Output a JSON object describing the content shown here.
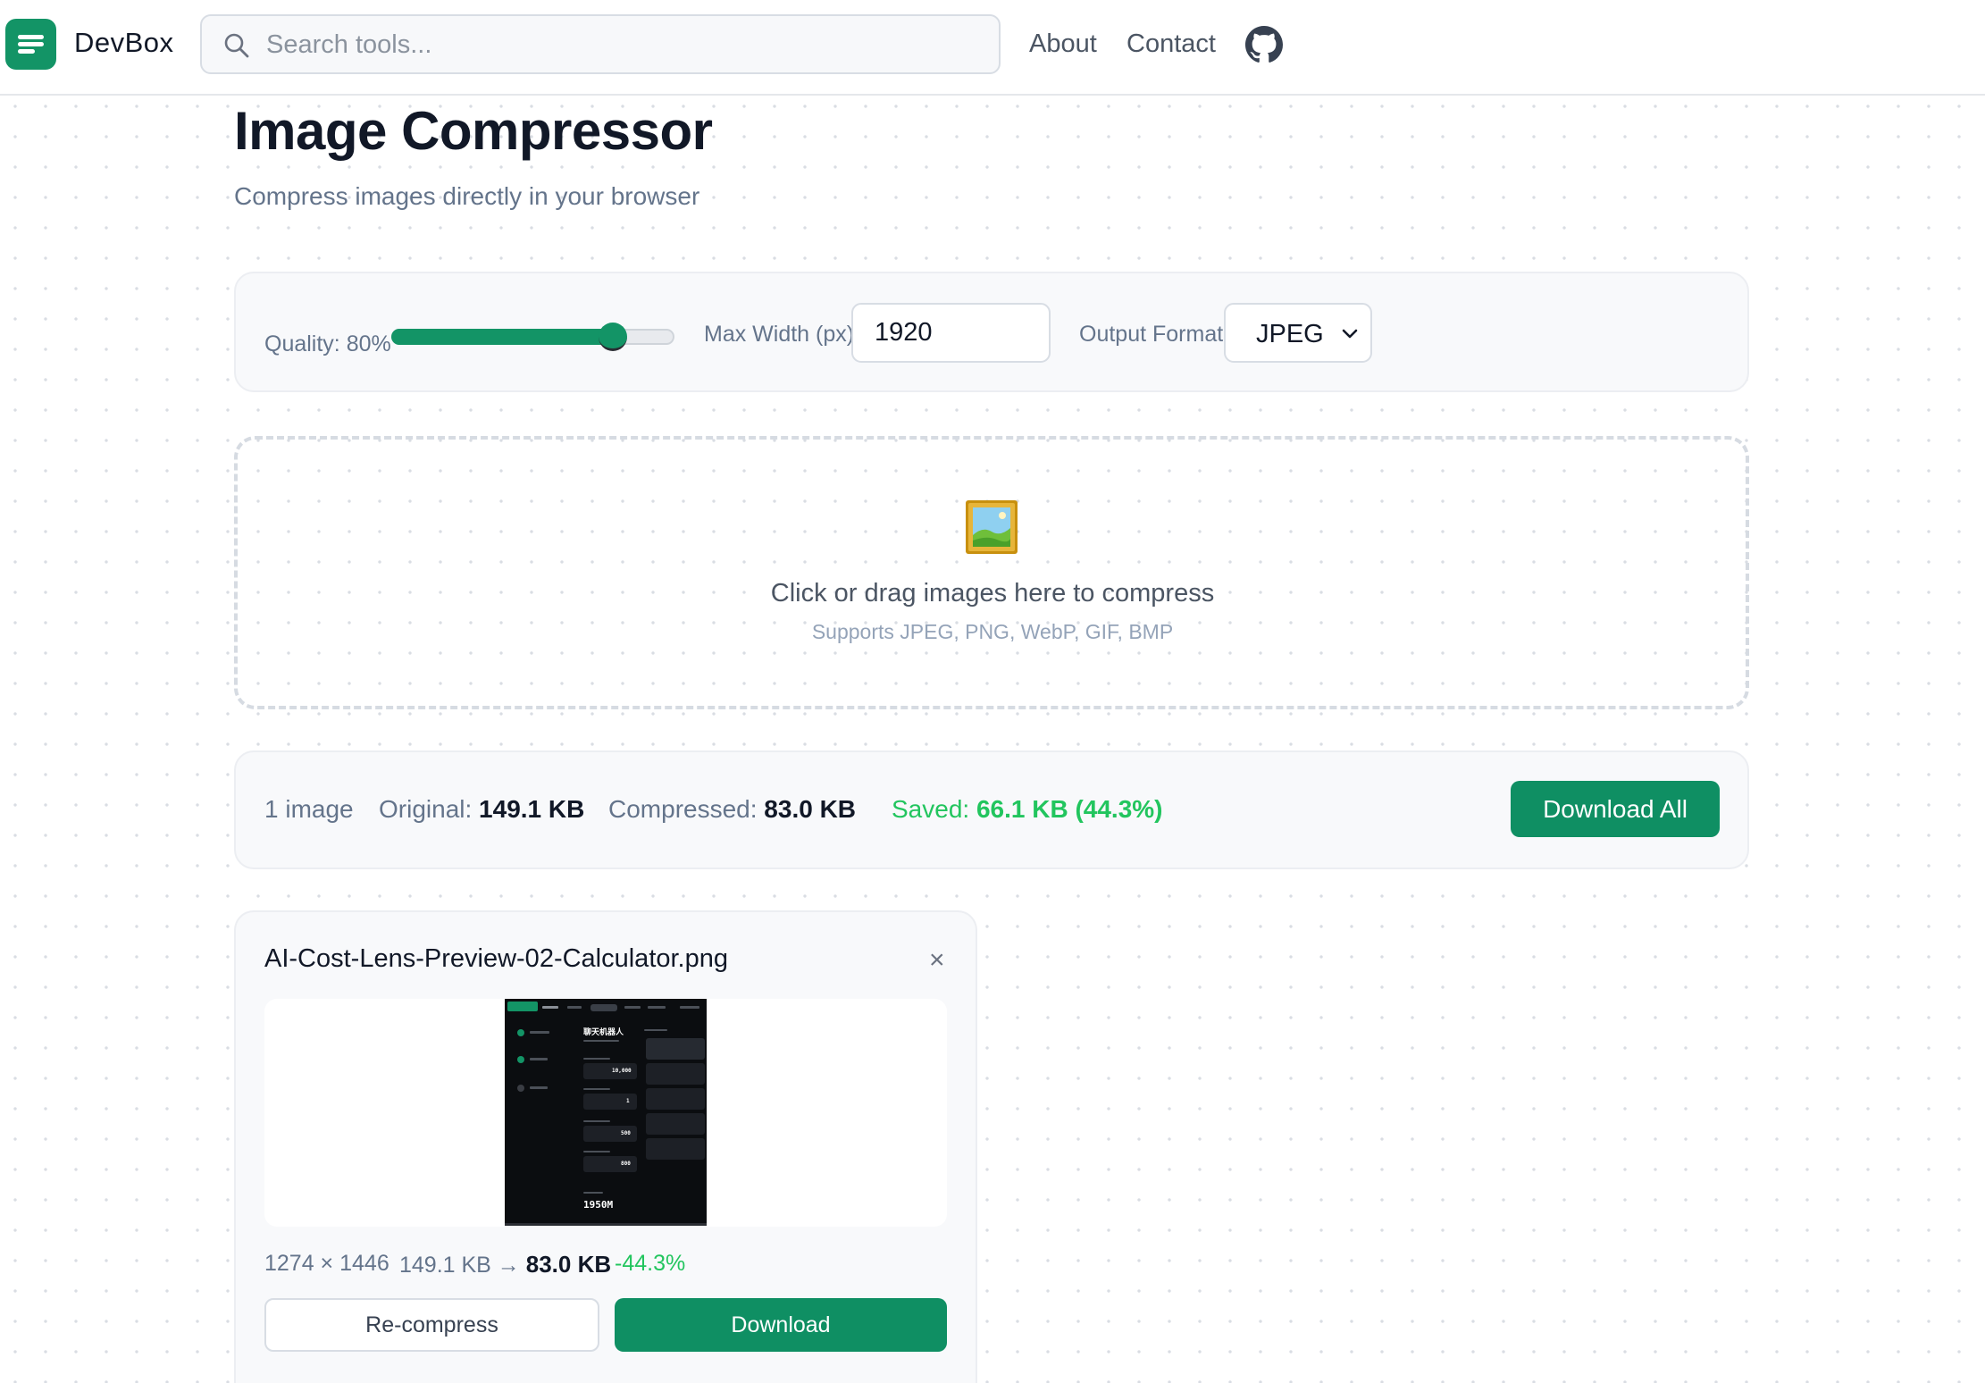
{
  "header": {
    "brand": "DevBox",
    "search_placeholder": "Search tools...",
    "nav": {
      "about": "About",
      "contact": "Contact"
    },
    "icons": {
      "logo": "menu-lines-icon",
      "search": "search-icon",
      "github": "github-icon"
    }
  },
  "page": {
    "title": "Image Compressor",
    "subtitle": "Compress images directly in your browser"
  },
  "settings": {
    "quality_label": "Quality: 80%",
    "quality_value": 80,
    "max_width_label": "Max Width (px)",
    "max_width_value": "1920",
    "format_label": "Output Format",
    "format_value": "JPEG"
  },
  "dropzone": {
    "icon": "framed-picture-icon",
    "main_text": "Click or drag images here to compress",
    "sub_text": "Supports JPEG, PNG, WebP, GIF, BMP"
  },
  "summary": {
    "count": "1 image",
    "original_label": "Original:",
    "original_value": "149.1 KB",
    "compressed_label": "Compressed:",
    "compressed_value": "83.0 KB",
    "saved_label": "Saved:",
    "saved_value": "66.1 KB (44.3%)",
    "download_all": "Download All"
  },
  "file": {
    "name": "AI-Cost-Lens-Preview-02-Calculator.png",
    "close": "×",
    "dimensions": "1274 × 1446",
    "original_size": "149.1 KB →",
    "compressed_size": "83.0 KB",
    "change": "-44.3%",
    "recompress": "Re-compress",
    "download": "Download",
    "preview_text": {
      "heading": "聊天机器人",
      "value_1": "10,000",
      "value_2": "1",
      "value_3": "500",
      "value_4": "800",
      "total": "1950M"
    }
  },
  "colors": {
    "accent": "#139466",
    "saved_green": "#22c55e",
    "muted_text": "#64748b",
    "title_text": "#111827"
  }
}
